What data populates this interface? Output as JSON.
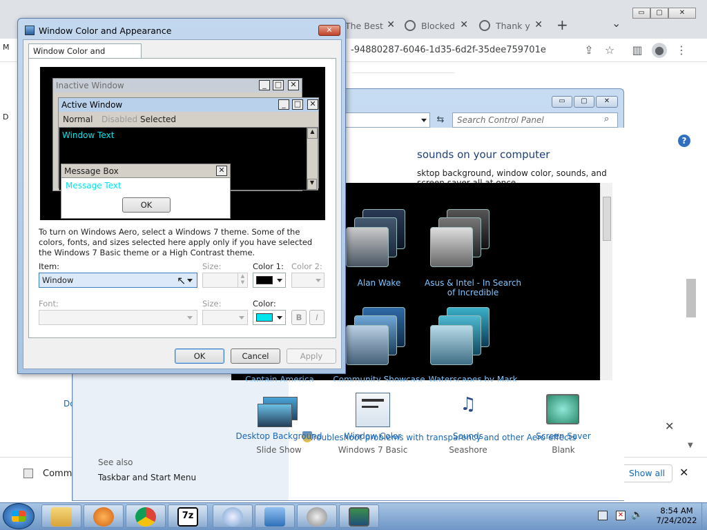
{
  "chrome": {
    "tabs": [
      {
        "label": "The Best"
      },
      {
        "label": "Blocked"
      },
      {
        "label": "Thank y"
      }
    ],
    "new_tab": "+",
    "tab_search": "⌄",
    "url": "-94880287-6046-1d35-6d2f-35dee759701e",
    "window_controls": {
      "min": "▭",
      "max": "▢",
      "close": "✕"
    },
    "left_fragments": {
      "m": "M",
      "d": "D",
      "do": "Do"
    }
  },
  "control_panel": {
    "search_placeholder": "Search Control Panel",
    "heading": "sounds on your computer",
    "description": "sktop background, window color, sounds, and screen saver all at once.",
    "help": "?",
    "themes": [
      {
        "name": "Alan Wake"
      },
      {
        "name": "Asus & Intel - In Search of Incredible"
      },
      {
        "name": "Captain America"
      },
      {
        "name": "Community Showcase"
      },
      {
        "name": "Waterscapes by Mark"
      }
    ],
    "bottom_items": [
      {
        "label": "Desktop Background",
        "value": "Slide Show"
      },
      {
        "label": "Window Color",
        "value": "Windows 7 Basic"
      },
      {
        "label": "Sounds",
        "value": "Seashore"
      },
      {
        "label": "Screen Saver",
        "value": "Blank"
      }
    ],
    "see_also": "See also",
    "taskbar_link": "Taskbar and Start Menu",
    "troubleshoot": "Troubleshoot problems with transparency and other Aero effects"
  },
  "notification": {
    "label": "Commu",
    "show_all": "Show all",
    "close": "✕"
  },
  "dialog": {
    "title": "Window Color and Appearance",
    "close": "✕",
    "tab": "Window Color and Appearance",
    "preview": {
      "inactive_title": "Inactive Window",
      "active_title": "Active Window",
      "menu": [
        "Normal",
        "Disabled",
        "Selected"
      ],
      "window_text": "Window Text",
      "msgbox_title": "Message Box",
      "msgbox_text": "Message Text",
      "msgbox_ok": "OK"
    },
    "info": "To turn on Windows Aero, select a Windows 7 theme.  Some of the colors, fonts, and sizes selected here apply only if you have selected the Windows 7 Basic theme or a High Contrast theme.",
    "item_label": "Item:",
    "item_value": "Window",
    "size_label": "Size:",
    "color1_label": "Color 1:",
    "color2_label": "Color 2:",
    "font_label": "Font:",
    "size2_label": "Size:",
    "color_label": "Color:",
    "color1_value": "#000000",
    "color_value": "#00e5ee",
    "bold": "B",
    "italic": "I",
    "ok": "OK",
    "cancel": "Cancel",
    "apply": "Apply"
  },
  "taskbar": {
    "time": "8:54 AM",
    "date": "7/24/2022"
  },
  "colors": {
    "accent_text": "#1a66b4",
    "preview_text": "#00e5ee"
  }
}
